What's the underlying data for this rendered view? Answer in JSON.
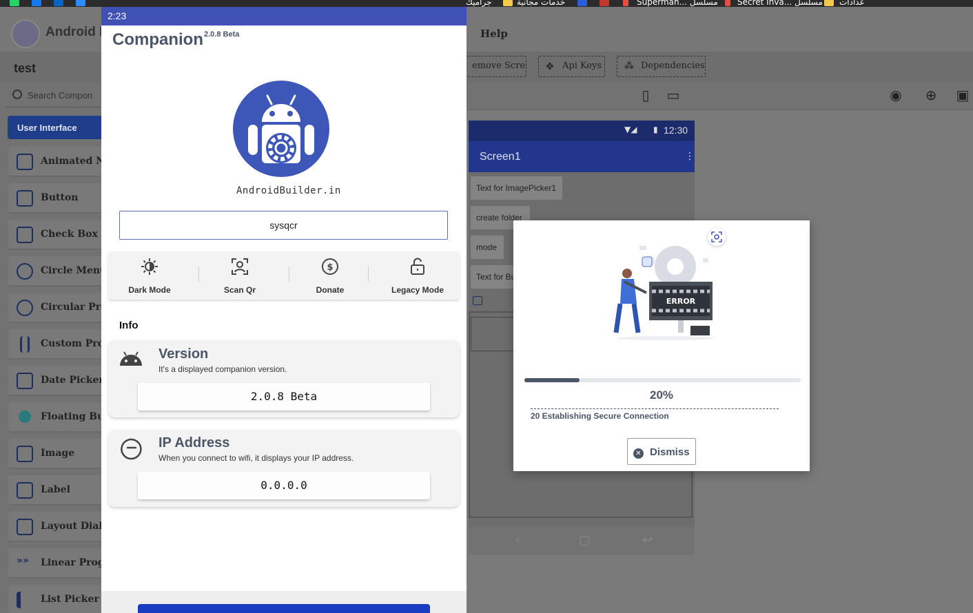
{
  "browser": {
    "bookmarks": [
      "جراميك",
      "خدمات مجانية",
      "Superman... مسلسل",
      "Secret Inva... مسلسل",
      "عدادات"
    ]
  },
  "ide": {
    "brand": "Android B",
    "menu_help": "Help",
    "project_name": "test",
    "toolbar": {
      "remove_screen": "emove Screen",
      "api_keys": "Api Keys",
      "dependencies": "Dependencies"
    },
    "palette": {
      "search_placeholder": "Search Compon",
      "tab_label": "User Interface",
      "items": [
        "Animated Na",
        "Button",
        "Check Box",
        "Circle Menu",
        "Circular Prog",
        "Custom Prog",
        "Date Picker",
        "Floating But",
        "Image",
        "Label",
        "Layout Dialo",
        "Linear Progr",
        "List Picker"
      ]
    },
    "emulator": {
      "time": "12:30",
      "screen_title": "Screen1",
      "buttons": [
        "Text for ImagePicker1",
        "create folder",
        "mode",
        "Text for Bu"
      ]
    }
  },
  "companion": {
    "time": "2:23",
    "title": "Companion",
    "version_sup": "2.0.8",
    "version_tag": "Beta",
    "site": "AndroidBuilder.in",
    "code_input": "sysqcr",
    "actions": [
      "Dark Mode",
      "Scan Qr",
      "Donate",
      "Legacy Mode"
    ],
    "info_heading": "Info",
    "version_card": {
      "title": "Version",
      "subtitle": "It's a displayed companion version.",
      "value": "2.0.8 Beta"
    },
    "ip_card": {
      "title": "IP Address",
      "subtitle": "When you connect to wifi, it displays your IP address.",
      "value": "0.0.0.0"
    }
  },
  "dialog": {
    "illustration_text": "ERROR",
    "progress_percent": 20,
    "progress_label": "20%",
    "status_message": "20 Establishing Secure Connection",
    "dismiss_label": "Dismiss"
  },
  "colors": {
    "companion_status_bar": "#3f51b5",
    "emulator_appbar": "#23368d",
    "logo_bg": "#3d57b8",
    "palette_tab": "#1f3d8a",
    "slate_text": "#4a5568"
  }
}
